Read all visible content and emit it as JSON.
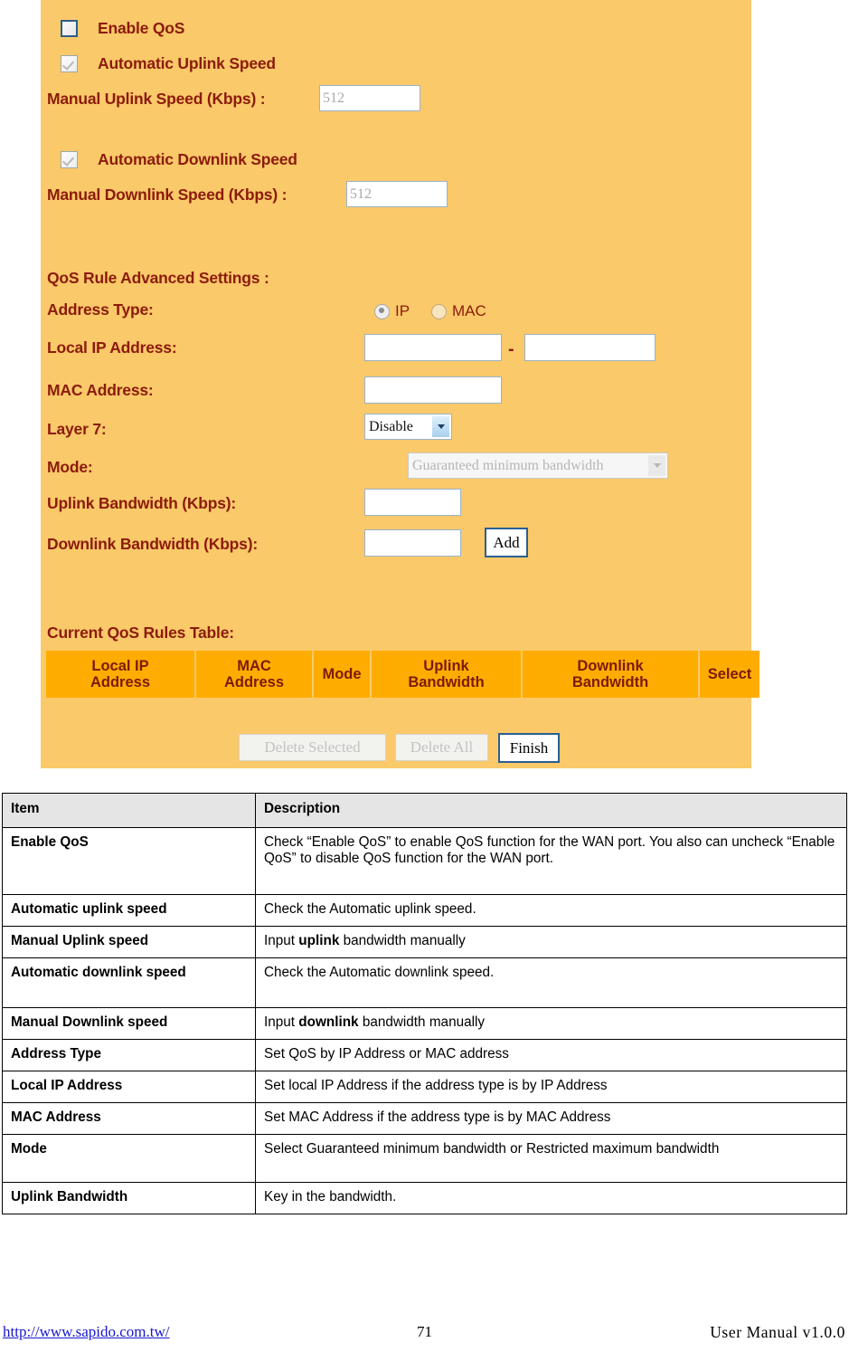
{
  "router_panel": {
    "checkboxes": [
      {
        "label": "Enable QoS",
        "checked": false,
        "focused": true
      },
      {
        "label": "Automatic Uplink Speed",
        "checked": true,
        "focused": false
      },
      {
        "label": "Automatic Downlink Speed",
        "checked": true,
        "focused": false
      }
    ],
    "manual_uplink": {
      "label": "Manual Uplink Speed (Kbps) :",
      "value": "512"
    },
    "manual_downlink": {
      "label": "Manual Downlink Speed (Kbps) :",
      "value": "512"
    },
    "advanced_heading": "QoS Rule Advanced Settings :",
    "address_type": {
      "label": "Address Type:",
      "options": [
        "IP",
        "MAC"
      ],
      "selected": "IP"
    },
    "local_ip": {
      "label": "Local IP Address:",
      "start": "",
      "end": "",
      "separator": "-"
    },
    "mac_address": {
      "label": "MAC Address:",
      "value": ""
    },
    "layer7": {
      "label": "Layer 7:",
      "value": "Disable",
      "disabled": false
    },
    "mode": {
      "label": "Mode:",
      "value": "Guaranteed minimum bandwidth",
      "disabled": true
    },
    "uplink_bandwidth": {
      "label": "Uplink Bandwidth (Kbps):",
      "value": ""
    },
    "downlink_bandwidth": {
      "label": "Downlink Bandwidth (Kbps):",
      "value": ""
    },
    "add_button": "Add",
    "rules_heading": "Current QoS Rules Table:",
    "rules_table": {
      "headers": [
        "Local IP\nAddress",
        "MAC\nAddress",
        "Mode",
        "Uplink\nBandwidth",
        "Downlink\nBandwidth",
        "Select"
      ],
      "header_local_ip_line1": "Local IP",
      "header_local_ip_line2": "Address",
      "header_mac_line1": "MAC",
      "header_mac_line2": "Address",
      "header_mode": "Mode",
      "header_uplink_line1": "Uplink",
      "header_uplink_line2": "Bandwidth",
      "header_downlink_line1": "Downlink",
      "header_downlink_line2": "Bandwidth",
      "header_select": "Select",
      "rows": []
    },
    "buttons": {
      "delete_selected": "Delete Selected",
      "delete_all": "Delete All",
      "finish": "Finish"
    },
    "colors": {
      "panel_background": "#fac96a",
      "label_text": "#8c1b0b",
      "table_header_cell": "#ffac00"
    }
  },
  "description_table": {
    "headers": [
      "Item",
      "Description"
    ],
    "rows": [
      {
        "item": "Enable QoS",
        "description": "Check “Enable QoS” to enable QoS function for the WAN port. You also can uncheck “Enable QoS” to disable QoS function for the WAN port."
      },
      {
        "item": "Automatic uplink speed",
        "description": "Check the Automatic uplink speed."
      },
      {
        "item": "Manual Uplink speed",
        "description_pre": "Input ",
        "description_bold": "uplink",
        "description_post": " bandwidth manually"
      },
      {
        "item": "Automatic downlink speed",
        "description": "Check the Automatic downlink speed."
      },
      {
        "item": "Manual Downlink speed",
        "description_pre": "Input ",
        "description_bold": "downlink",
        "description_post": " bandwidth manually"
      },
      {
        "item": "Address Type",
        "description": "Set QoS by IP Address or MAC address"
      },
      {
        "item": "Local IP Address",
        "description": "Set local IP Address if the address type is by IP Address"
      },
      {
        "item": "MAC Address",
        "description": "Set MAC Address if the address type is by MAC Address"
      },
      {
        "item": "Mode",
        "description": "Select Guaranteed minimum bandwidth or Restricted maximum bandwidth"
      },
      {
        "item": "Uplink Bandwidth",
        "description": "Key in the bandwidth."
      }
    ]
  },
  "footer": {
    "link": "http://www.sapido.com.tw/",
    "page_number": "71",
    "manual": "User  Manual  v1.0.0"
  }
}
